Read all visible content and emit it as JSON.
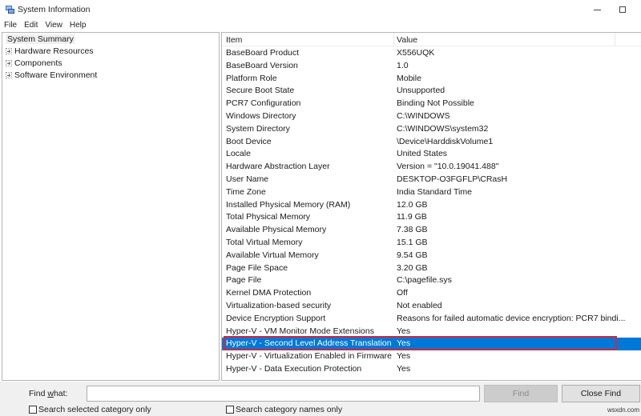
{
  "window": {
    "title": "System Information",
    "icon": "system-information-icon",
    "controls": [
      "minimize",
      "maximize"
    ]
  },
  "menu": [
    "File",
    "Edit",
    "View",
    "Help"
  ],
  "tree": {
    "root": "System Summary",
    "children": [
      "Hardware Resources",
      "Components",
      "Software Environment"
    ]
  },
  "list": {
    "headers": {
      "item": "Item",
      "value": "Value"
    },
    "rows": [
      {
        "item": "BaseBoard Product",
        "value": "X556UQK"
      },
      {
        "item": "BaseBoard Version",
        "value": "1.0"
      },
      {
        "item": "Platform Role",
        "value": "Mobile"
      },
      {
        "item": "Secure Boot State",
        "value": "Unsupported"
      },
      {
        "item": "PCR7 Configuration",
        "value": "Binding Not Possible"
      },
      {
        "item": "Windows Directory",
        "value": "C:\\WINDOWS"
      },
      {
        "item": "System Directory",
        "value": "C:\\WINDOWS\\system32"
      },
      {
        "item": "Boot Device",
        "value": "\\Device\\HarddiskVolume1"
      },
      {
        "item": "Locale",
        "value": "United States"
      },
      {
        "item": "Hardware Abstraction Layer",
        "value": "Version = \"10.0.19041.488\""
      },
      {
        "item": "User Name",
        "value": "DESKTOP-O3FGFLP\\CRasH"
      },
      {
        "item": "Time Zone",
        "value": "India Standard Time"
      },
      {
        "item": "Installed Physical Memory (RAM)",
        "value": "12.0 GB"
      },
      {
        "item": "Total Physical Memory",
        "value": "11.9 GB"
      },
      {
        "item": "Available Physical Memory",
        "value": "7.38 GB"
      },
      {
        "item": "Total Virtual Memory",
        "value": "15.1 GB"
      },
      {
        "item": "Available Virtual Memory",
        "value": "9.54 GB"
      },
      {
        "item": "Page File Space",
        "value": "3.20 GB"
      },
      {
        "item": "Page File",
        "value": "C:\\pagefile.sys"
      },
      {
        "item": "Kernel DMA Protection",
        "value": "Off"
      },
      {
        "item": "Virtualization-based security",
        "value": "Not enabled"
      },
      {
        "item": "Device Encryption Support",
        "value": "Reasons for failed automatic device encryption: PCR7 bindi..."
      },
      {
        "item": "Hyper-V - VM Monitor Mode Extensions",
        "value": "Yes"
      },
      {
        "item": "Hyper-V - Second Level Address Translation ...",
        "value": "Yes",
        "selected": true
      },
      {
        "item": "Hyper-V - Virtualization Enabled in Firmware",
        "value": "Yes"
      },
      {
        "item": "Hyper-V - Data Execution Protection",
        "value": "Yes"
      }
    ]
  },
  "find": {
    "label": "Find what:",
    "input_value": "",
    "find_button": "Find",
    "close_button": "Close Find",
    "checkbox_selected_category": "Search selected category only",
    "checkbox_category_names": "Search category names only",
    "checkbox_selected_category_checked": false,
    "checkbox_category_names_checked": false
  },
  "colors": {
    "selection": "#0078d7",
    "highlight_border": "#d3263a"
  },
  "watermark": "wsxdn.com"
}
